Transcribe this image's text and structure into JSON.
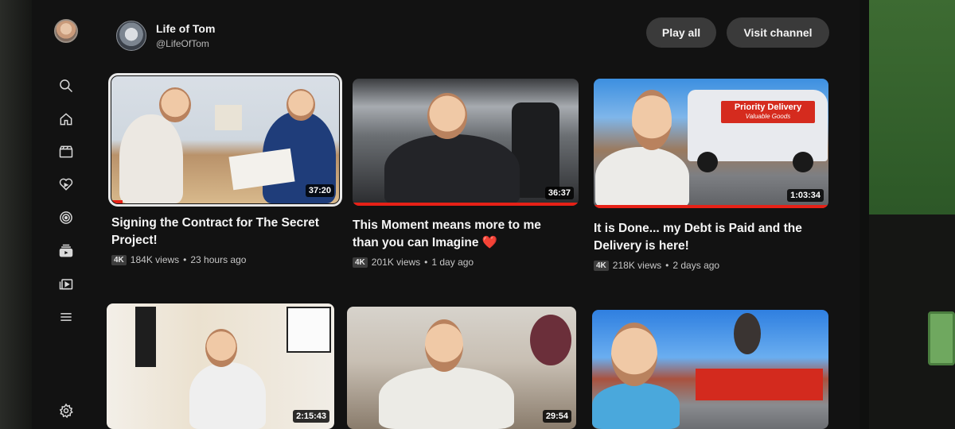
{
  "rail": {
    "icons": [
      "account-avatar",
      "search-icon",
      "home-icon",
      "clapperboard-icon",
      "subscriptions-icon",
      "live-icon",
      "library-icon",
      "playlist-icon",
      "menu-icon",
      "settings-icon"
    ]
  },
  "channel": {
    "name": "Life of Tom",
    "handle": "@LifeOfTom",
    "play_all_label": "Play all",
    "visit_label": "Visit channel"
  },
  "videos": [
    {
      "title_line1": "Signing the Contract for The Secret",
      "title_line2": "Project!",
      "badge": "4K",
      "views": "184K views",
      "age": "23 hours ago",
      "duration": "37:20",
      "watched_fraction": 0.05,
      "focused": true
    },
    {
      "title_line1": "This Moment means more to me",
      "title_line2": "than you can Imagine",
      "heart": "❤️",
      "badge": "4K",
      "views": "201K views",
      "age": "1 day ago",
      "duration": "36:37",
      "watched_fraction": 1.0
    },
    {
      "title_line1": "It is Done... my Debt is Paid and the",
      "title_line2": "Delivery is here!",
      "badge": "4K",
      "views": "218K views",
      "age": "2 days ago",
      "duration": "1:03:34",
      "watched_fraction": 1.0,
      "sign_main": "Priority Delivery",
      "sign_sub": "Valuable Goods"
    },
    {
      "duration": "2:15:43"
    },
    {
      "duration": "29:54"
    },
    {
      "duration": ""
    }
  ],
  "separator": "•",
  "colors": {
    "progress": "#e62117",
    "screen_bg": "#121212",
    "pill_bg": "#3a3a3a"
  }
}
